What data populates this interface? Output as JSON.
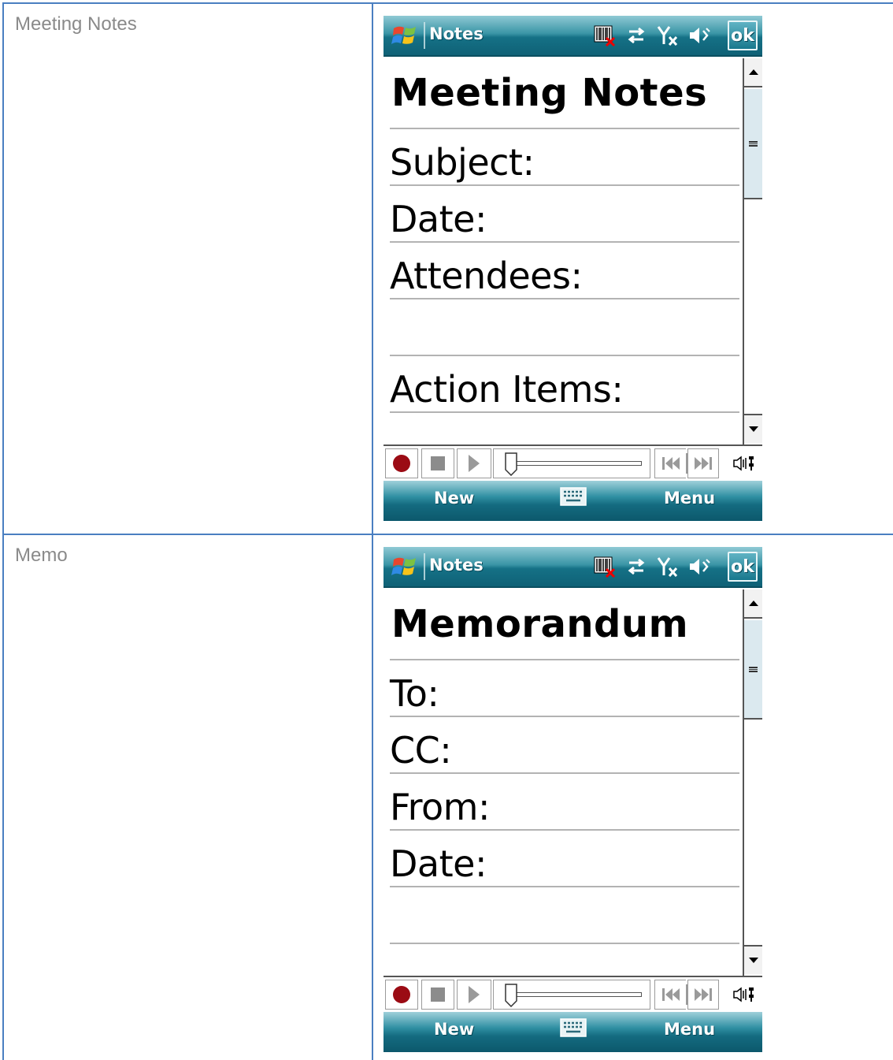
{
  "rows": [
    {
      "label": "Meeting Notes",
      "phone": {
        "app_title": "Notes",
        "ok_label": "ok",
        "note_title": "Meeting Notes",
        "fields": [
          "Subject:",
          "Date:",
          "Attendees:",
          "",
          "Action Items:",
          ""
        ],
        "softkey_left": "New",
        "softkey_right": "Menu"
      }
    },
    {
      "label": "Memo",
      "phone": {
        "app_title": "Notes",
        "ok_label": "ok",
        "note_title": "Memorandum",
        "fields": [
          "To:",
          "CC:",
          "From:",
          "Date:",
          "",
          ""
        ],
        "softkey_left": "New",
        "softkey_right": "Menu"
      }
    }
  ],
  "status_icons": [
    "barcode-scanner-icon",
    "data-sync-icon",
    "no-signal-icon",
    "speaker-icon"
  ],
  "colors": {
    "table_border": "#4a7fc1",
    "titlebar_teal": "#157186",
    "record_red": "#9b0b14",
    "label_gray": "#8a8a8a"
  }
}
